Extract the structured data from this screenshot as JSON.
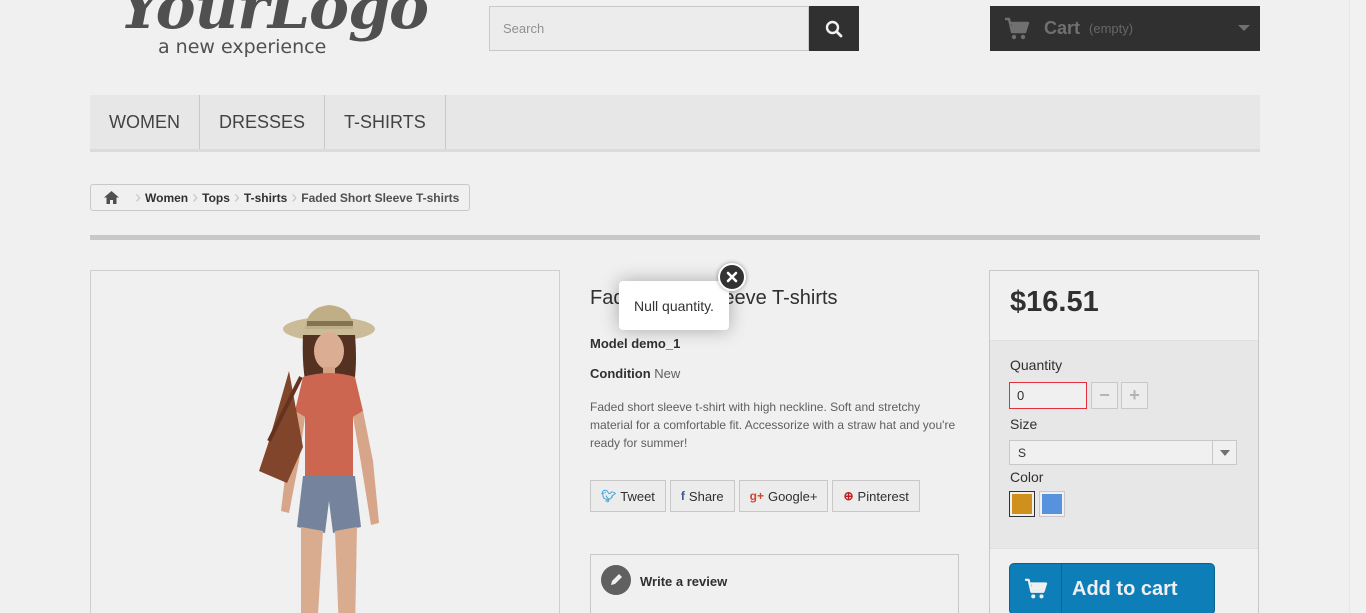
{
  "header": {
    "logo": {
      "main": "YourLogo",
      "sub": "a new experience"
    },
    "search": {
      "placeholder": "Search",
      "value": ""
    },
    "cart": {
      "label": "Cart",
      "status": "(empty)"
    }
  },
  "topmenu": {
    "items": [
      "WOMEN",
      "DRESSES",
      "T-SHIRTS"
    ]
  },
  "breadcrumb": {
    "items": [
      "Women",
      "Tops",
      "T-shirts"
    ],
    "current": "Faded Short Sleeve T-shirts"
  },
  "product": {
    "title": "Faded Short Sleeve T-shirts",
    "reference_label": "Model",
    "reference": "demo_1",
    "condition_label": "Condition",
    "condition": "New",
    "description": "Faded short sleeve t-shirt with high neckline. Soft and stretchy material for a comfortable fit. Accessorize with a straw hat and you're ready for summer!",
    "social": [
      "Tweet",
      "Share",
      "Google+",
      "Pinterest"
    ],
    "review": "Write a review"
  },
  "buybox": {
    "price": "$16.51",
    "quantity_label": "Quantity",
    "quantity": "0",
    "size_label": "Size",
    "size_selected": "S",
    "color_label": "Color",
    "colors": [
      "#dc9b1e",
      "#5d9cec"
    ],
    "add_to_cart": "Add to cart"
  },
  "popup": {
    "message": "Null quantity."
  },
  "colors": {
    "dark": "#333333",
    "addcart": "#0f86c4",
    "error_border": "#f13340"
  }
}
